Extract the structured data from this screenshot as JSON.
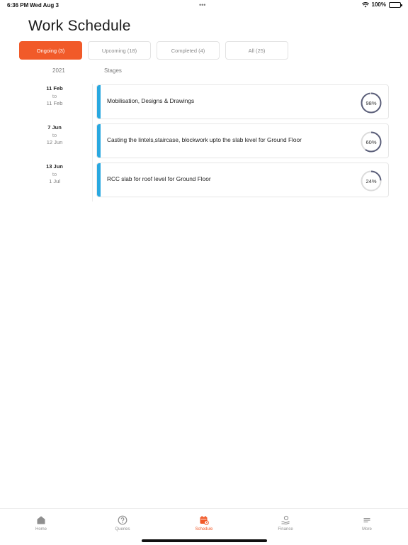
{
  "status_bar": {
    "time": "6:36 PM",
    "date": "Wed Aug 3",
    "battery": "100%"
  },
  "page": {
    "title": "Work Schedule"
  },
  "tabs": [
    {
      "label": "Ongoing (3)",
      "active": true
    },
    {
      "label": "Upcoming (18)",
      "active": false
    },
    {
      "label": "Completed (4)",
      "active": false
    },
    {
      "label": "All (25)",
      "active": false
    }
  ],
  "columns": {
    "year": "2021",
    "stages": "Stages"
  },
  "schedule": [
    {
      "start": "11 Feb",
      "to": "to",
      "end": "11 Feb",
      "stage": "Mobilisation, Designs & Drawings",
      "progress_label": "98%",
      "progress": 98
    },
    {
      "start": "7 Jun",
      "to": "to",
      "end": "12 Jun",
      "stage": "Casting the lintels,staircase, blockwork upto the slab level for Ground Floor",
      "progress_label": "60%",
      "progress": 60
    },
    {
      "start": "13 Jun",
      "to": "to",
      "end": "1 Jul",
      "stage": "RCC slab for roof level for Ground Floor",
      "progress_label": "24%",
      "progress": 24
    }
  ],
  "tabbar": [
    {
      "label": "Home",
      "icon": "home-icon",
      "active": false
    },
    {
      "label": "Queries",
      "icon": "question-icon",
      "active": false
    },
    {
      "label": "Schedule",
      "icon": "calendar-icon",
      "active": true
    },
    {
      "label": "Finance",
      "icon": "finance-icon",
      "active": false
    },
    {
      "label": "More",
      "icon": "menu-icon",
      "active": false
    }
  ],
  "colors": {
    "accent": "#f15a29",
    "stage_bar": "#29a8e0",
    "progress_ring": "#5b5f7a",
    "progress_track": "#dcdcdc"
  }
}
